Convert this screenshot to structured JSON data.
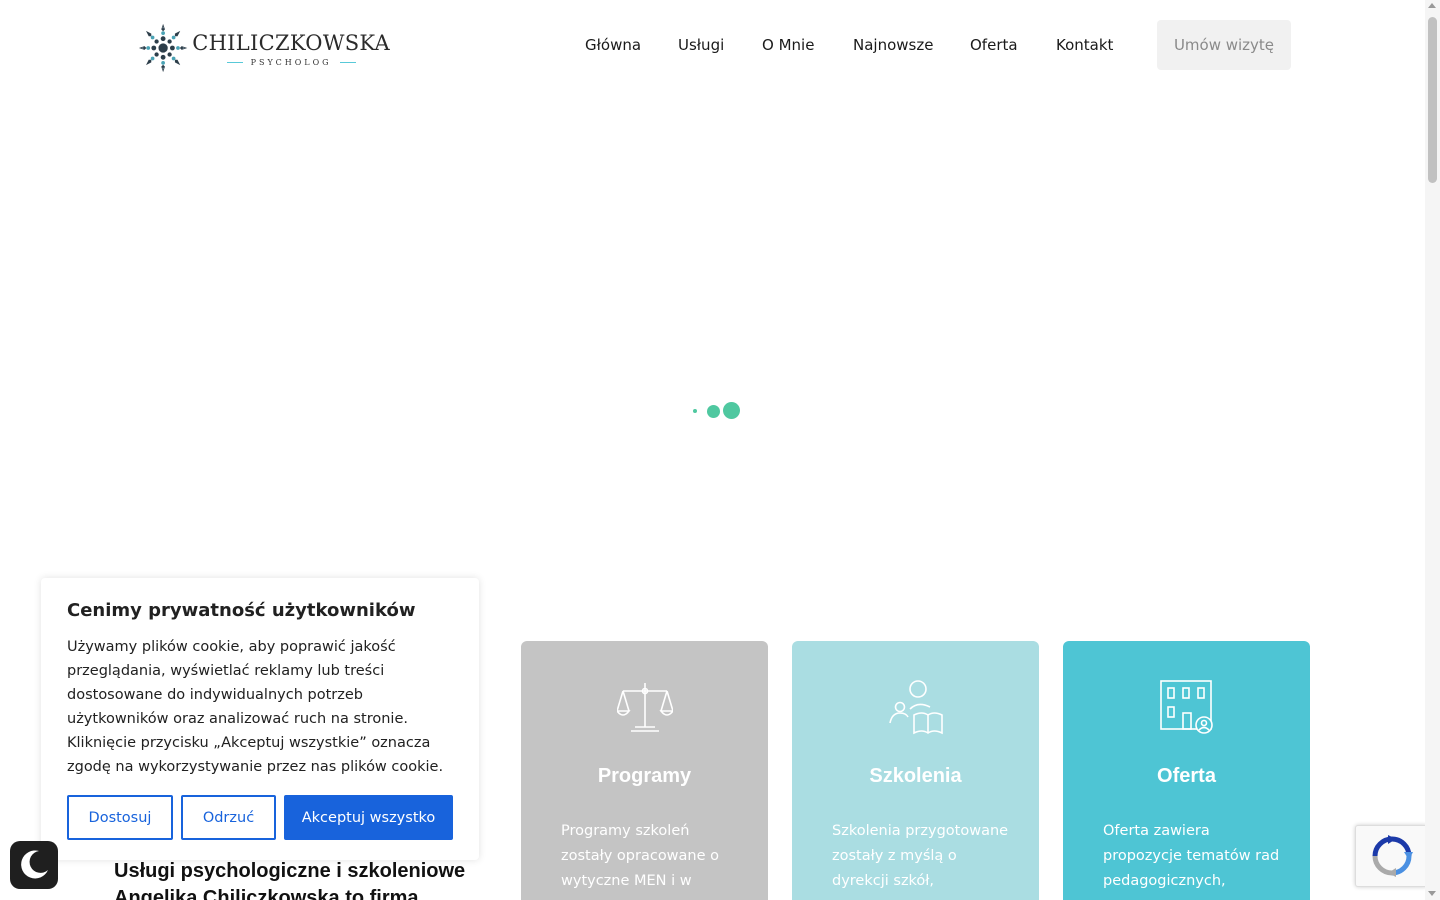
{
  "header": {
    "logo": {
      "name": "CHILICZKOWSKA",
      "subtitle": "PSYCHOLOG",
      "icon": "mandala-logo-icon"
    },
    "nav": [
      "Główna",
      "Usługi",
      "O Mnie",
      "Najnowsze",
      "Oferta",
      "Kontakt"
    ],
    "cta_label": "Umów wizytę"
  },
  "loader": {
    "icon": "loading-dots",
    "color": "#4fc8a0"
  },
  "cards": [
    {
      "title": "Programy",
      "text": "Programy szkoleń zostały opracowane o wytyczne MEN i w",
      "icon": "scales-icon",
      "color": "#c4c4c4"
    },
    {
      "title": "Szkolenia",
      "text": "Szkolenia przygotowane zostały z myślą o dyrekcji szkół,",
      "icon": "teacher-book-icon",
      "color": "#aadde2"
    },
    {
      "title": "Oferta",
      "text": "Oferta zawiera propozycje tematów rad pedagogicznych,",
      "icon": "school-building-icon",
      "color": "#4ec5d4"
    }
  ],
  "about": {
    "heading": "Usługi psychologiczne i szkoleniowe Angelika Chiliczkowska to firma"
  },
  "cookie_banner": {
    "title": "Cenimy prywatność użytkowników",
    "text": "Używamy plików cookie, aby poprawić jakość przeglądania, wyświetlać reklamy lub treści dostosowane do indywidualnych potrzeb użytkowników oraz analizować ruch na stronie. Kliknięcie przycisku „Akceptuj wszystkie” oznacza zgodę na wykorzystywanie przez nas plików cookie.",
    "customize_label": "Dostosuj",
    "reject_label": "Odrzuć",
    "accept_label": "Akceptuj wszystko",
    "accent": "#1863dc"
  },
  "widgets": {
    "darkmode_icon": "moon-icon",
    "recaptcha_icon": "recaptcha-icon"
  }
}
